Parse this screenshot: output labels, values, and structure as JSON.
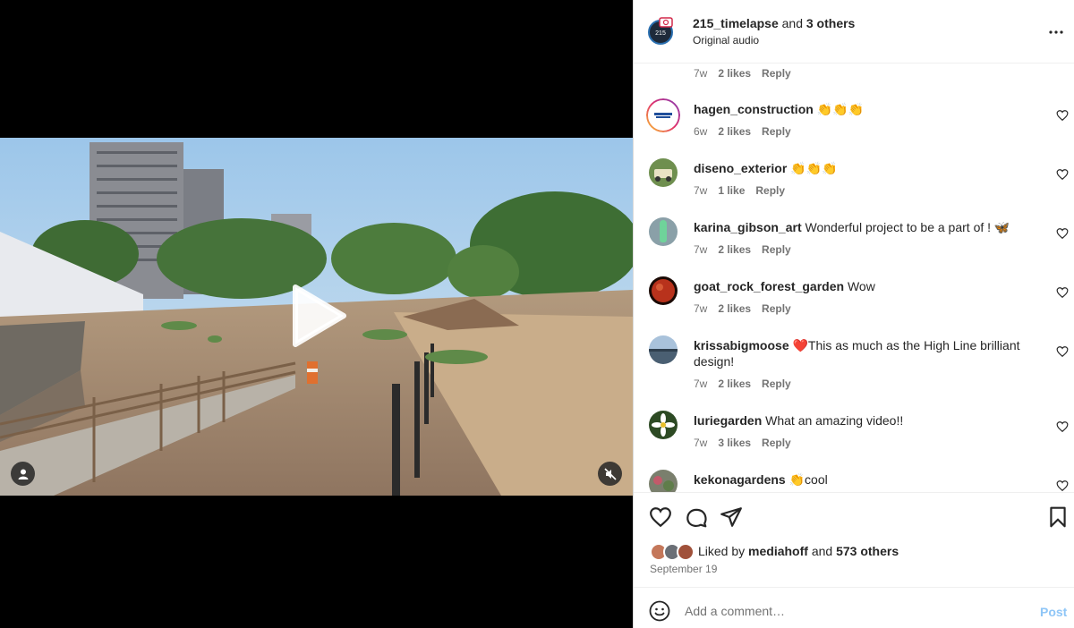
{
  "post": {
    "author": "215_timelapse",
    "author_suffix": " and ",
    "coauthors": "3 others",
    "audio": "Original audio",
    "avatar_text": "215"
  },
  "comments_top_meta": {
    "time": "7w",
    "likes": "2 likes",
    "reply": "Reply"
  },
  "comments": [
    {
      "user": "hagen_construction",
      "text": " 👏👏👏",
      "time": "6w",
      "likes": "2 likes",
      "reply": "Reply",
      "avatar_icon": "hagen-logo-icon"
    },
    {
      "user": "diseno_exterior",
      "text": " 👏👏👏",
      "time": "7w",
      "likes": "1 like",
      "reply": "Reply",
      "avatar_icon": "truck-photo-icon"
    },
    {
      "user": "karina_gibson_art",
      "text": " Wonderful project to be a part of ! 🦋",
      "time": "7w",
      "likes": "2 likes",
      "reply": "Reply",
      "avatar_icon": "statue-photo-icon"
    },
    {
      "user": "goat_rock_forest_garden",
      "text": " Wow",
      "time": "7w",
      "likes": "2 likes",
      "reply": "Reply",
      "avatar_icon": "moon-photo-icon"
    },
    {
      "user": "krissabigmoose",
      "text": " ❤️This as much as the High Line brilliant design!",
      "time": "7w",
      "likes": "2 likes",
      "reply": "Reply",
      "avatar_icon": "landscape-photo-icon"
    },
    {
      "user": "luriegarden",
      "text": " What an amazing video!!",
      "time": "7w",
      "likes": "3 likes",
      "reply": "Reply",
      "avatar_icon": "flower-photo-icon"
    },
    {
      "user": "kekonagardens",
      "text": " 👏cool",
      "time": "",
      "likes": "",
      "reply": "",
      "avatar_icon": "garden-photo-icon"
    }
  ],
  "likes": {
    "prefix": "Liked by ",
    "user": "mediahoff",
    "middle": " and ",
    "others": "573 others"
  },
  "date": "September 19",
  "add_comment": {
    "placeholder": "Add a comment…",
    "post_label": "Post"
  },
  "colors": {
    "post_disabled": "#8fc6f7",
    "muted": "#737373",
    "text": "#262626"
  }
}
